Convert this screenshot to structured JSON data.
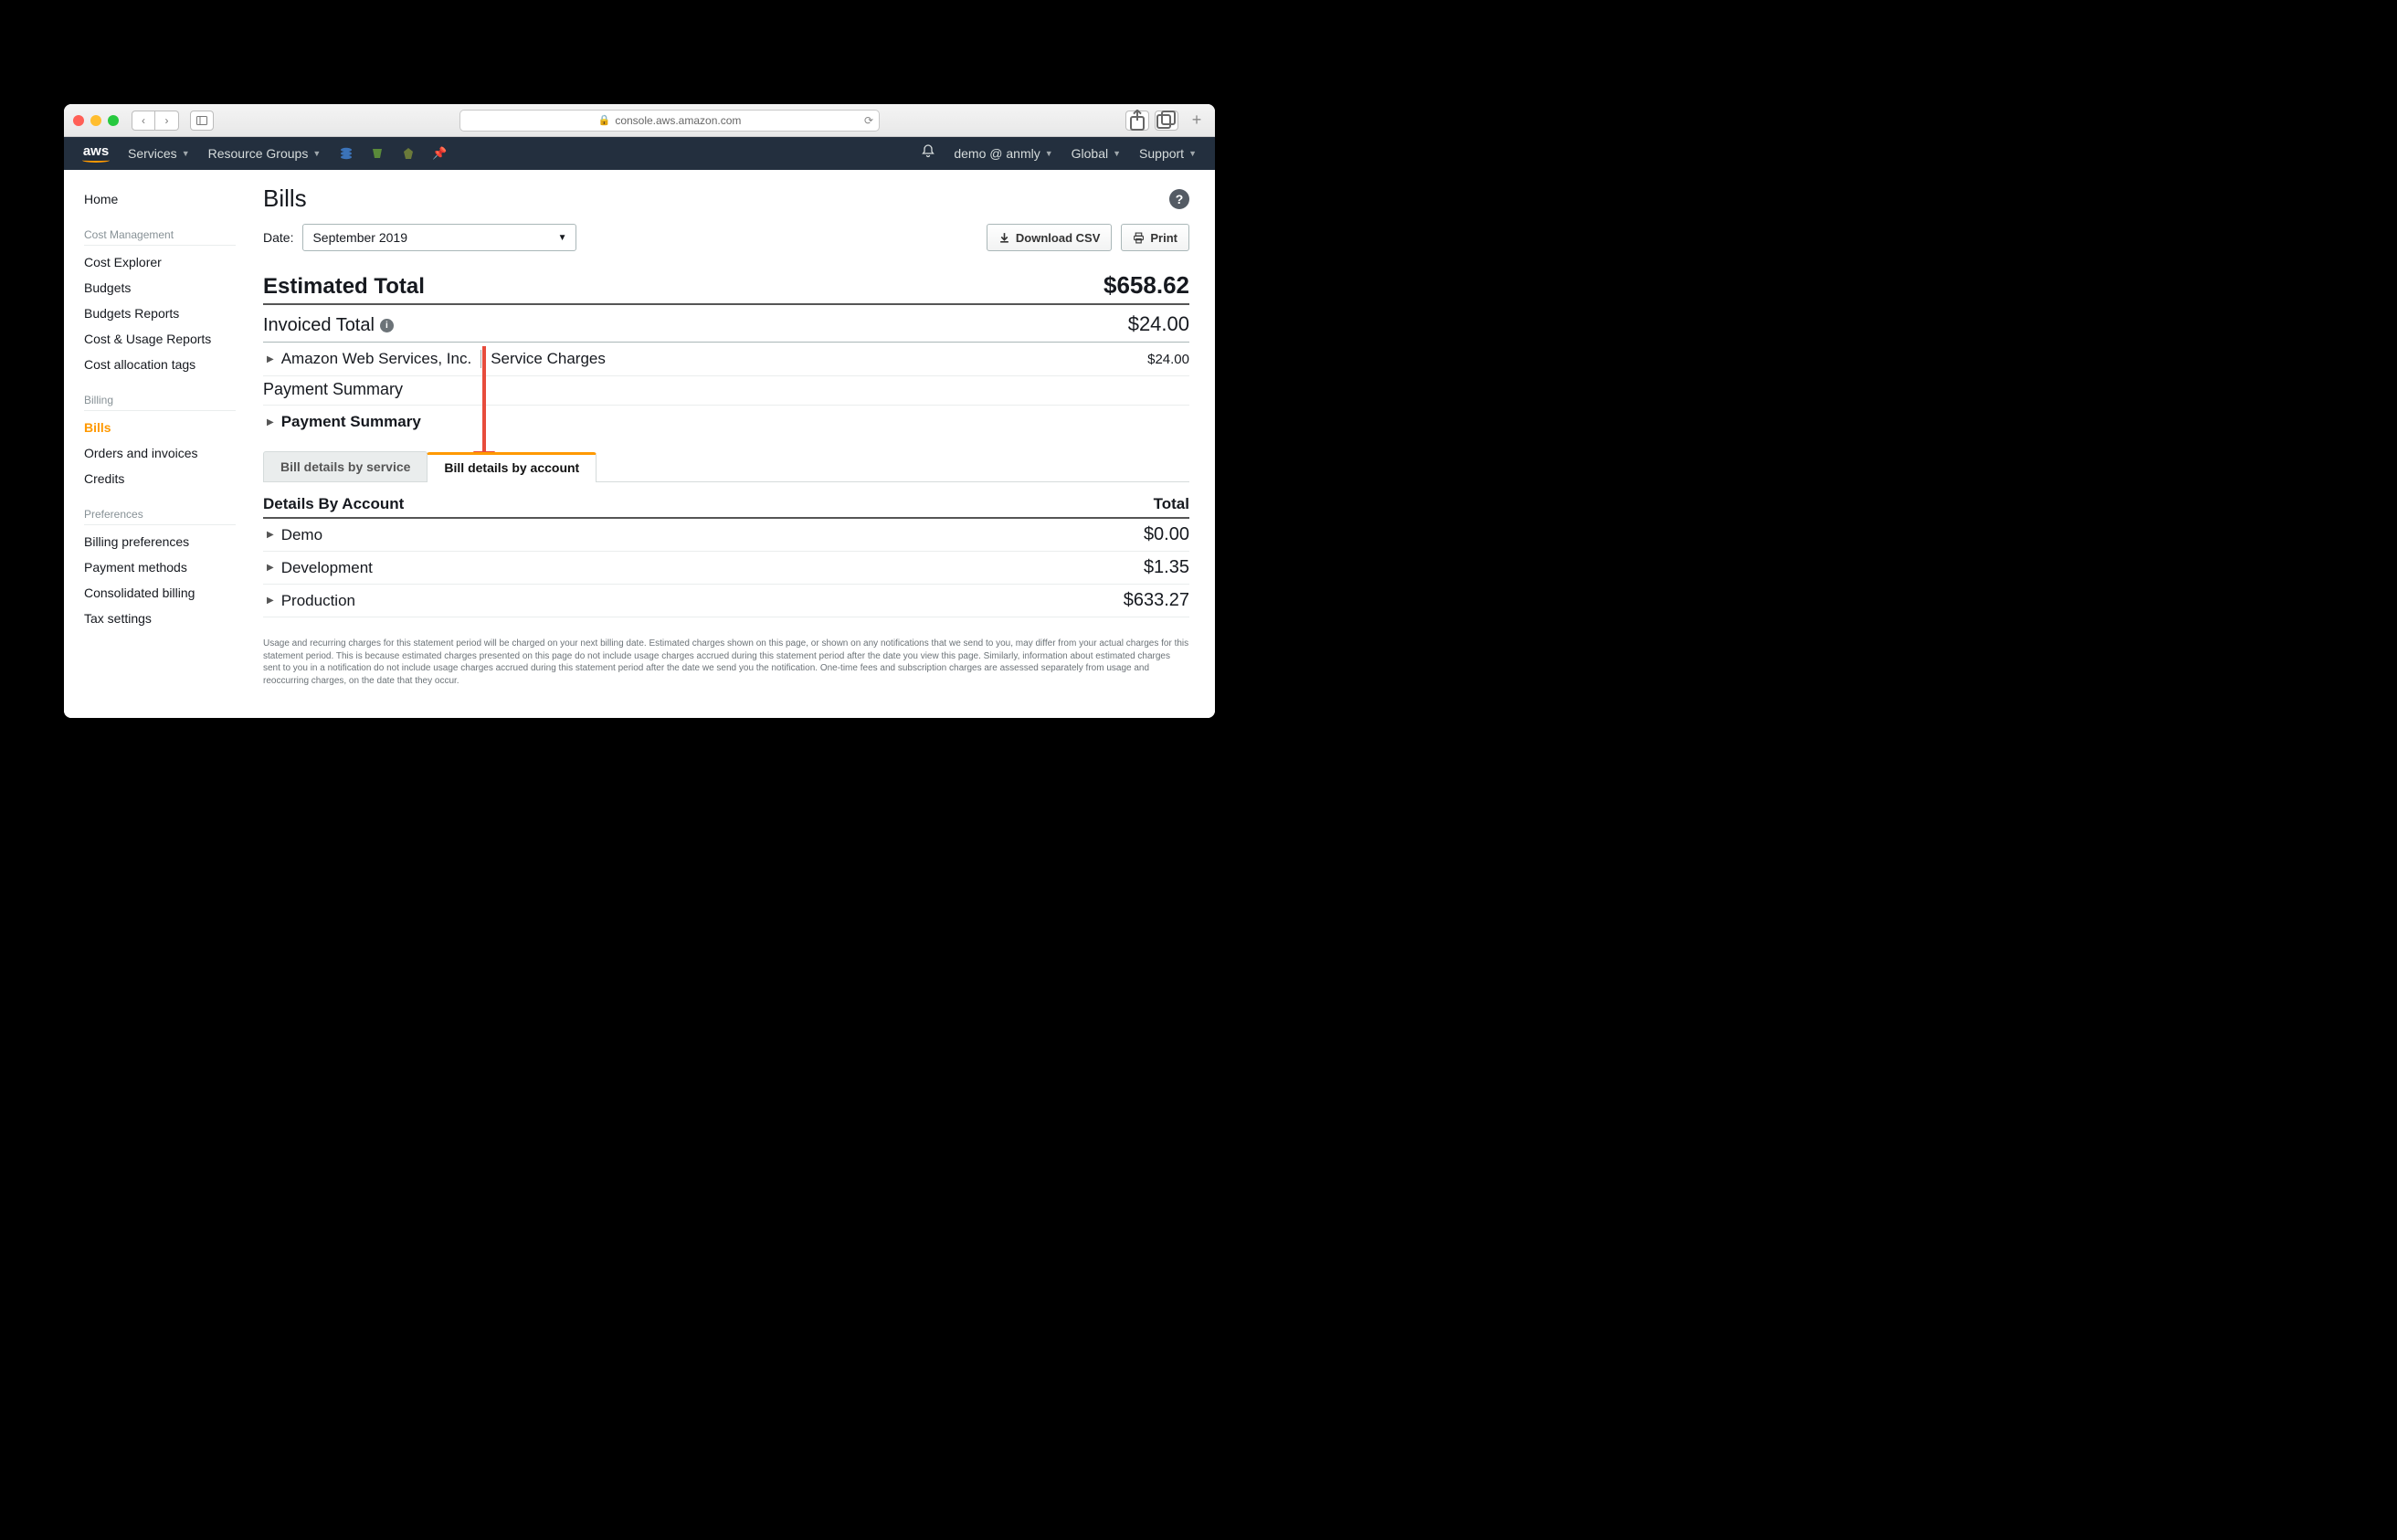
{
  "browser": {
    "url": "console.aws.amazon.com"
  },
  "navbar": {
    "services": "Services",
    "resource_groups": "Resource Groups",
    "user": "demo @ anmly",
    "region": "Global",
    "support": "Support"
  },
  "sidebar": {
    "home": "Home",
    "headers": {
      "cost_mgmt": "Cost Management",
      "billing": "Billing",
      "prefs": "Preferences"
    },
    "cost_explorer": "Cost Explorer",
    "budgets": "Budgets",
    "budgets_reports": "Budgets Reports",
    "cost_usage_reports": "Cost & Usage Reports",
    "cost_alloc_tags": "Cost allocation tags",
    "bills": "Bills",
    "orders_invoices": "Orders and invoices",
    "credits": "Credits",
    "billing_prefs": "Billing preferences",
    "payment_methods": "Payment methods",
    "consolidated": "Consolidated billing",
    "tax": "Tax settings"
  },
  "page": {
    "title": "Bills",
    "date_label": "Date:",
    "date_value": "September 2019",
    "download_csv": "Download CSV",
    "print": "Print",
    "estimated_label": "Estimated Total",
    "estimated_value": "$658.62",
    "invoiced_label": "Invoiced Total",
    "invoiced_value": "$24.00",
    "vendor": "Amazon Web Services, Inc.",
    "vendor_desc": "Service Charges",
    "vendor_amount": "$24.00",
    "payment_summary_head": "Payment Summary",
    "payment_summary_row": "Payment Summary",
    "tab_service": "Bill details by service",
    "tab_account": "Bill details by account",
    "details_head": "Details By Account",
    "details_total": "Total",
    "accounts": [
      {
        "name": "Demo",
        "amount": "$0.00"
      },
      {
        "name": "Development",
        "amount": "$1.35"
      },
      {
        "name": "Production",
        "amount": "$633.27"
      }
    ],
    "fine_print": "Usage and recurring charges for this statement period will be charged on your next billing date. Estimated charges shown on this page, or shown on any notifications that we send to you, may differ from your actual charges for this statement period. This is because estimated charges presented on this page do not include usage charges accrued during this statement period after the date you view this page. Similarly, information about estimated charges sent to you in a notification do not include usage charges accrued during this statement period after the date we send you the notification. One-time fees and subscription charges are assessed separately from usage and reoccurring charges, on the date that they occur."
  }
}
